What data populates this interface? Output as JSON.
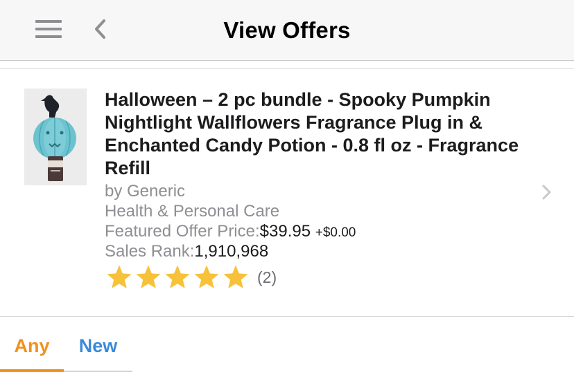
{
  "header": {
    "title": "View Offers",
    "menu_icon": "hamburger-menu-icon",
    "back_icon": "chevron-left-icon",
    "background_color": "#f7f7f7"
  },
  "product": {
    "title": "Halloween – 2 pc bundle - Spooky Pumpkin Nightlight Wallflowers Fragrance Plug in & Enchanted Candy Potion - 0.8 fl oz - Fragrance Refill",
    "brand": "by Generic",
    "category": "Health & Personal Care",
    "price_label": "Featured Offer Price:",
    "price": "$39.95",
    "shipping": "+$0.00",
    "rank_label": "Sales Rank:",
    "rank": "1,910,968",
    "rating": 5,
    "review_count": "(2)",
    "star_color": "#f7c23a",
    "chevron_icon": "chevron-right-icon"
  },
  "tabs": [
    {
      "label": "Any",
      "active": true,
      "color": "#f0911f"
    },
    {
      "label": "New",
      "active": false,
      "color": "#3b8ad9"
    }
  ]
}
